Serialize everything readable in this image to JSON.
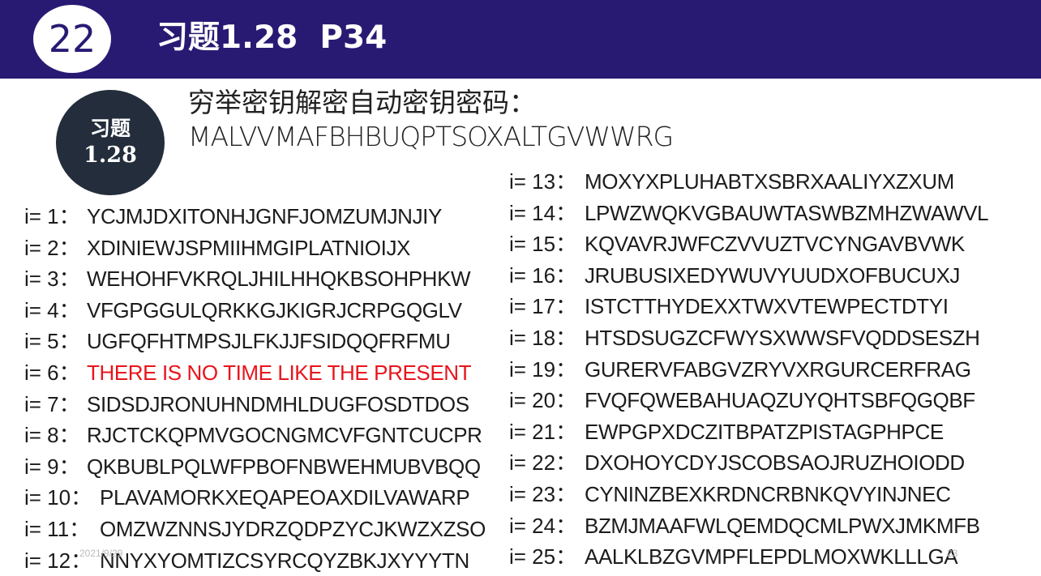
{
  "slide": {
    "number": "22",
    "title": "习题1.28  P34",
    "badge_line1": "习题",
    "badge_line2": "1.28",
    "intro_line1": "穷举密钥解密自动密钥密码：",
    "cipher": "MALVVMAFBHBUQPTSOXALTGVWWRG",
    "footer_left": "2021/9/29",
    "footer_right": "23"
  },
  "left_rows": [
    {
      "label": "i= 1：",
      "text": "YCJMJDXITONHJGNFJOMZUMJNJIY"
    },
    {
      "label": "i= 2：",
      "text": "XDINIEWJSPMIIHMGIPLATNIOIJX"
    },
    {
      "label": "i= 3：",
      "text": "WEHOHFVKRQLJHILHHQKBSOHPHKW"
    },
    {
      "label": "i= 4：",
      "text": "VFGPGGULQRKKGJKIGRJCRPGQGLV"
    },
    {
      "label": "i= 5：",
      "text": "UGFQFHTMPSJLFKJJFSIDQQFRFMU"
    },
    {
      "label": "i= 6：",
      "text": "THERE IS NO TIME LIKE THE PRESENT",
      "highlight": true
    },
    {
      "label": "i= 7：",
      "text": "SIDSDJRONUHNDMHLDUGFOSDTDOS"
    },
    {
      "label": "i= 8：",
      "text": "RJCTCKQPMVGOCNGMCVFGNTCUCPR"
    },
    {
      "label": "i= 9：",
      "text": "QKBUBLPQLWFPBOFNBWEHMUBVBQQ"
    },
    {
      "label": "i= 10：",
      "text": "PLAVAMORKXEQAPEOAXDILVAWARP"
    },
    {
      "label": "i= 11：",
      "text": "OMZWZNNSJYDRZQDPZYCJKWZXZSO"
    },
    {
      "label": "i= 12：",
      "text": "NNYXYOMTIZCSYRCQYZBKJXYYYTN"
    }
  ],
  "right_rows": [
    {
      "label": "i= 13：",
      "text": "MOXYXPLUHABTXSBRXAALIYXZXUM"
    },
    {
      "label": "i= 14：",
      "text": "LPWZWQKVGBAUWTASWBZMHZWAWVL"
    },
    {
      "label": "i= 15：",
      "text": "KQVAVRJWFCZVVUZTVCYNGAVBVWK"
    },
    {
      "label": "i= 16：",
      "text": "JRUBUSIXEDYWUVYUUDXOFBUCUXJ"
    },
    {
      "label": "i= 17：",
      "text": "ISTCTTHYDEXXTWXVTEWPECTDTYI"
    },
    {
      "label": "i= 18：",
      "text": "HTSDSUGZCFWYSXWWSFVQDDSESZH"
    },
    {
      "label": "i= 19：",
      "text": "GURERVFABGVZRYVXRGURCERFRAG"
    },
    {
      "label": "i= 20：",
      "text": "FVQFQWEBAHUAQZUYQHTSBFQGQBF"
    },
    {
      "label": "i= 21：",
      "text": "EWPGPXDCZITBPATZPISTAGPHPCE"
    },
    {
      "label": "i= 22：",
      "text": "DXOHOYCDYJSCOBSAOJRUZHOIODD"
    },
    {
      "label": "i= 23：",
      "text": "CYNINZBEXKRDNCRBNKQVYINJNEC"
    },
    {
      "label": "i= 24：",
      "text": "BZMJMAAFWLQEMDQCMLPWXJMKMFB"
    },
    {
      "label": "i= 25：",
      "text": "AALKLBZGVMPFLEPDLMOXWKLLLGA"
    }
  ]
}
